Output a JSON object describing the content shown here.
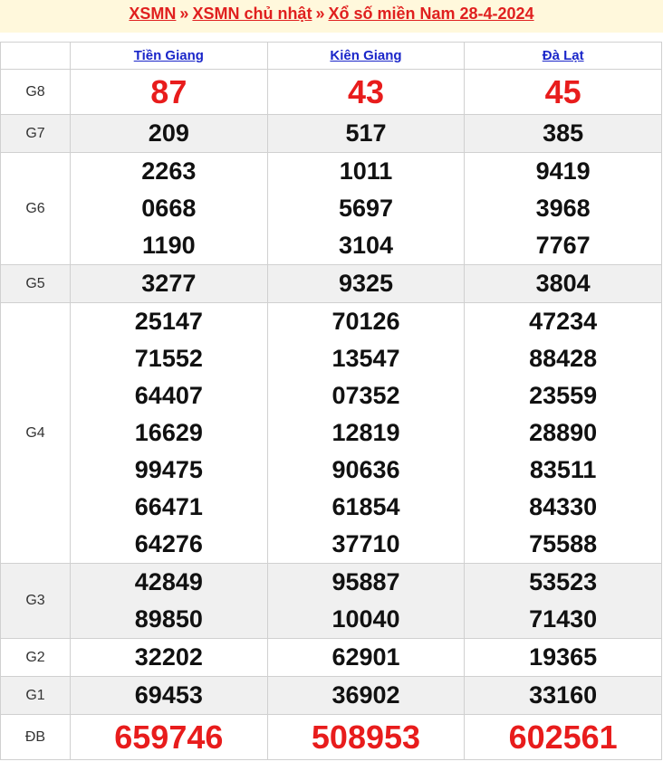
{
  "breadcrumb": {
    "items": [
      "XSMN",
      "XSMN chủ nhật",
      "Xổ số miền Nam 28-4-2024"
    ],
    "separator": "»"
  },
  "columns": [
    "Tiền Giang",
    "Kiên Giang",
    "Đà Lạt"
  ],
  "rows": [
    {
      "label": "G8",
      "values": [
        [
          "87"
        ],
        [
          "43"
        ],
        [
          "45"
        ]
      ],
      "highlight": true
    },
    {
      "label": "G7",
      "values": [
        [
          "209"
        ],
        [
          "517"
        ],
        [
          "385"
        ]
      ]
    },
    {
      "label": "G6",
      "values": [
        [
          "2263",
          "0668",
          "1190"
        ],
        [
          "1011",
          "5697",
          "3104"
        ],
        [
          "9419",
          "3968",
          "7767"
        ]
      ]
    },
    {
      "label": "G5",
      "values": [
        [
          "3277"
        ],
        [
          "9325"
        ],
        [
          "3804"
        ]
      ]
    },
    {
      "label": "G4",
      "values": [
        [
          "25147",
          "71552",
          "64407",
          "16629",
          "99475",
          "66471",
          "64276"
        ],
        [
          "70126",
          "13547",
          "07352",
          "12819",
          "90636",
          "61854",
          "37710"
        ],
        [
          "47234",
          "88428",
          "23559",
          "28890",
          "83511",
          "84330",
          "75588"
        ]
      ]
    },
    {
      "label": "G3",
      "values": [
        [
          "42849",
          "89850"
        ],
        [
          "95887",
          "10040"
        ],
        [
          "53523",
          "71430"
        ]
      ]
    },
    {
      "label": "G2",
      "values": [
        [
          "32202"
        ],
        [
          "62901"
        ],
        [
          "19365"
        ]
      ]
    },
    {
      "label": "G1",
      "values": [
        [
          "69453"
        ],
        [
          "36902"
        ],
        [
          "33160"
        ]
      ]
    },
    {
      "label": "ĐB",
      "values": [
        [
          "659746"
        ],
        [
          "508953"
        ],
        [
          "602561"
        ]
      ],
      "highlight": true
    }
  ],
  "colors": {
    "accent": "#e81c1c",
    "link": "#1a26c9",
    "header_bg": "#fff8dc",
    "alt_row": "#f0f0f0"
  }
}
